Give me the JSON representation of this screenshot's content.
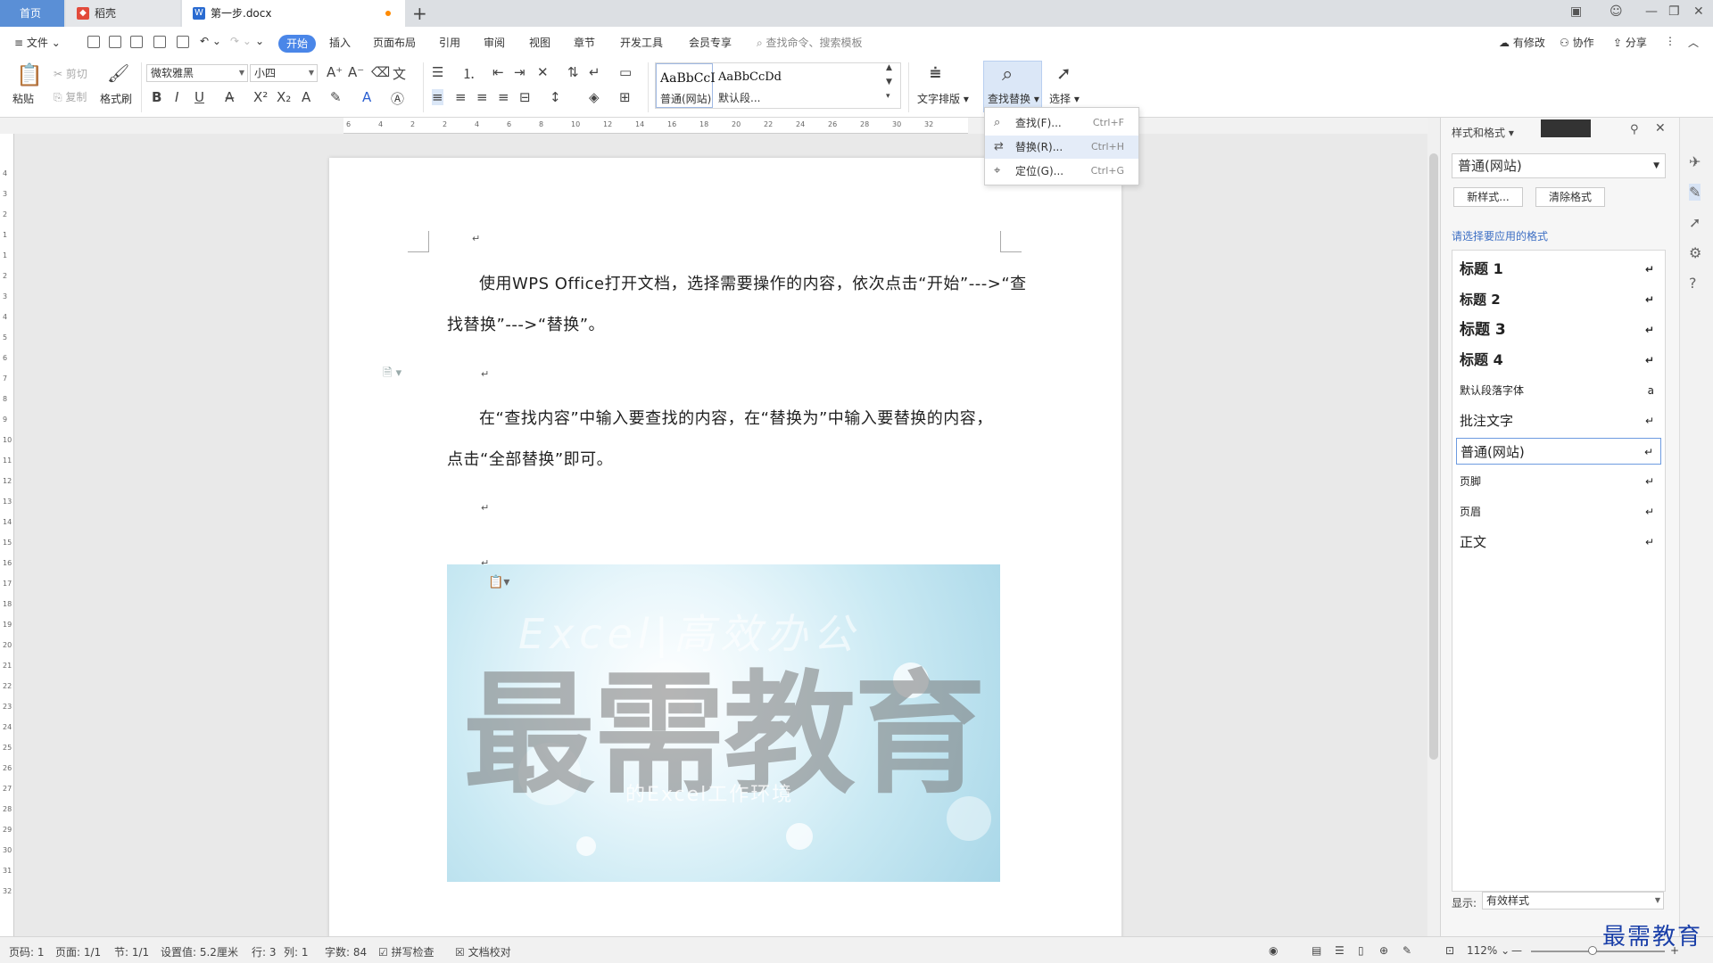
{
  "tabs": {
    "home": "首页",
    "daoke": "稻壳",
    "document": "第一步.docx"
  },
  "menu": {
    "file": "文件",
    "start": "开始",
    "items": [
      "插入",
      "页面布局",
      "引用",
      "审阅",
      "视图",
      "章节",
      "开发工具",
      "会员专享"
    ],
    "search_placeholder": "查找命令、搜索模板",
    "modified": "有修改",
    "collab": "协作",
    "share": "分享"
  },
  "ribbon": {
    "paste": "粘贴",
    "cut": "剪切",
    "copy": "复制",
    "format_painter": "格式刷",
    "font_name": "微软雅黑",
    "font_size": "小四",
    "gallery": [
      {
        "preview": "AaBbCcI",
        "name": "普通(网站)"
      },
      {
        "preview": "AaBbCcDd",
        "name": "默认段..."
      }
    ],
    "text_layout": "文字排版",
    "find_replace": "查找替换",
    "select": "选择"
  },
  "find_menu": [
    {
      "label": "查找(F)...",
      "shortcut": "Ctrl+F",
      "icon": "search-icon"
    },
    {
      "label": "替换(R)...",
      "shortcut": "Ctrl+H",
      "icon": "replace-icon"
    },
    {
      "label": "定位(G)...",
      "shortcut": "Ctrl+G",
      "icon": "goto-icon"
    }
  ],
  "ruler": {
    "horizontal": [
      "6",
      "4",
      "2",
      "2",
      "4",
      "6",
      "8",
      "10",
      "12",
      "14",
      "16",
      "18",
      "20",
      "22",
      "24",
      "26",
      "28",
      "30",
      "32"
    ],
    "vertical": [
      "4",
      "3",
      "2",
      "1",
      "1",
      "2",
      "3",
      "4",
      "5",
      "6",
      "7",
      "8",
      "9",
      "10",
      "11",
      "12",
      "13",
      "14",
      "15",
      "16",
      "17",
      "18",
      "19",
      "20",
      "21",
      "22",
      "23",
      "24",
      "25",
      "26",
      "27",
      "28",
      "29",
      "30",
      "31",
      "32"
    ]
  },
  "document": {
    "para1_line1": "使用WPS Office打开文档，选择需要操作的内容，依次点击“开始”--->“查",
    "para1_line2": "找替换”--->“替换”。",
    "para2_line1": "在“查找内容”中输入要查找的内容，在“替换为”中输入要替换的内容，",
    "para2_line2": "点击“全部替换”即可。",
    "pmark": "↵",
    "image_subtitle": "Excel|高效办公",
    "image_watermark": "最需教育",
    "image_caption": "的Excel工作环境"
  },
  "pane": {
    "title": "样式和格式",
    "current_style": "普通(网站)",
    "new_style": "新样式...",
    "clear_format": "清除格式",
    "prompt": "请选择要应用的格式",
    "styles": [
      {
        "label": "标题  1",
        "ret": "↵"
      },
      {
        "label": "标题  2",
        "ret": "↵"
      },
      {
        "label": "标题  3",
        "ret": "↵"
      },
      {
        "label": "标题  4",
        "ret": "↵"
      },
      {
        "label": "默认段落字体",
        "ret": "a"
      },
      {
        "label": "批注文字",
        "ret": "↵"
      },
      {
        "label": "普通(网站)",
        "ret": "↵"
      },
      {
        "label": "页脚",
        "ret": "↵"
      },
      {
        "label": "页眉",
        "ret": "↵"
      },
      {
        "label": "正文",
        "ret": "↵"
      }
    ],
    "show_label": "显示:",
    "show_value": "有效样式"
  },
  "status": {
    "page_code": "页码: 1",
    "page": "页面: 1/1",
    "section": "节: 1/1",
    "setting": "设置值: 5.2厘米",
    "row": "行: 3",
    "col": "列: 1",
    "words": "字数: 84",
    "spell": "拼写检查",
    "proof": "文档校对",
    "zoom": "112%"
  },
  "brand": "最需教育",
  "colors": {
    "accent": "#4a86e8",
    "home_tab": "#5a8fd6",
    "brand": "#1a3fa8"
  }
}
